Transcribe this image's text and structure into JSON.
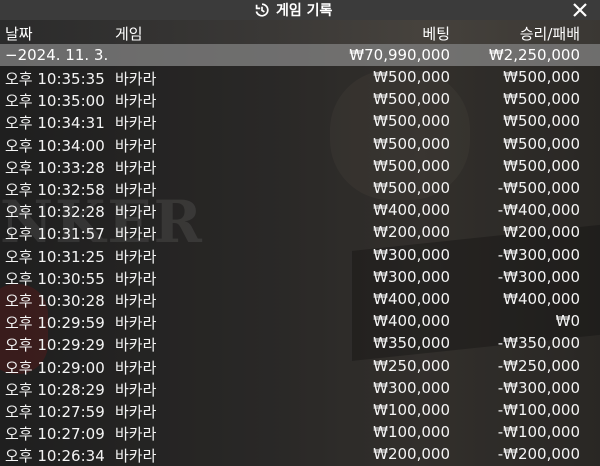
{
  "header": {
    "title": "게임 기록",
    "history_icon": "history-icon",
    "close_icon": "close-icon"
  },
  "columns": {
    "date": "날짜",
    "game": "게임",
    "bet": "베팅",
    "win_loss": "승리/패배"
  },
  "summary": {
    "date": "−2024. 11. 3.",
    "bet": "₩70,990,000",
    "win_loss": "₩2,250,000"
  },
  "background_text": "NKER",
  "rows": [
    {
      "time": "오후 10:35:35",
      "game": "바카라",
      "bet": "₩500,000",
      "result": "₩500,000"
    },
    {
      "time": "오후 10:35:00",
      "game": "바카라",
      "bet": "₩500,000",
      "result": "₩500,000"
    },
    {
      "time": "오후 10:34:31",
      "game": "바카라",
      "bet": "₩500,000",
      "result": "₩500,000"
    },
    {
      "time": "오후 10:34:00",
      "game": "바카라",
      "bet": "₩500,000",
      "result": "₩500,000"
    },
    {
      "time": "오후 10:33:28",
      "game": "바카라",
      "bet": "₩500,000",
      "result": "₩500,000"
    },
    {
      "time": "오후 10:32:58",
      "game": "바카라",
      "bet": "₩500,000",
      "result": "-₩500,000"
    },
    {
      "time": "오후 10:32:28",
      "game": "바카라",
      "bet": "₩400,000",
      "result": "-₩400,000"
    },
    {
      "time": "오후 10:31:57",
      "game": "바카라",
      "bet": "₩200,000",
      "result": "₩200,000"
    },
    {
      "time": "오후 10:31:25",
      "game": "바카라",
      "bet": "₩300,000",
      "result": "-₩300,000"
    },
    {
      "time": "오후 10:30:55",
      "game": "바카라",
      "bet": "₩300,000",
      "result": "-₩300,000"
    },
    {
      "time": "오후 10:30:28",
      "game": "바카라",
      "bet": "₩400,000",
      "result": "₩400,000"
    },
    {
      "time": "오후 10:29:59",
      "game": "바카라",
      "bet": "₩400,000",
      "result": "₩0"
    },
    {
      "time": "오후 10:29:29",
      "game": "바카라",
      "bet": "₩350,000",
      "result": "-₩350,000"
    },
    {
      "time": "오후 10:29:00",
      "game": "바카라",
      "bet": "₩250,000",
      "result": "-₩250,000"
    },
    {
      "time": "오후 10:28:29",
      "game": "바카라",
      "bet": "₩300,000",
      "result": "-₩300,000"
    },
    {
      "time": "오후 10:27:59",
      "game": "바카라",
      "bet": "₩100,000",
      "result": "-₩100,000"
    },
    {
      "time": "오후 10:27:09",
      "game": "바카라",
      "bet": "₩100,000",
      "result": "-₩100,000"
    },
    {
      "time": "오후 10:26:34",
      "game": "바카라",
      "bet": "₩200,000",
      "result": "-₩200,000"
    }
  ]
}
